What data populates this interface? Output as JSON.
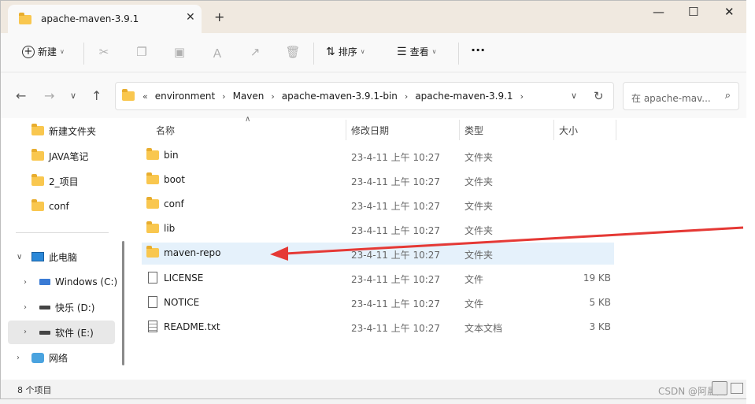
{
  "window": {
    "tab_title": "apache-maven-3.9.1",
    "tab_close": "✕",
    "new_tab": "+",
    "minimize": "—",
    "maximize": "☐",
    "close": "✕"
  },
  "toolbar": {
    "new_label": "新建",
    "sort_label": "排序",
    "view_label": "查看",
    "more_label": "···"
  },
  "address": {
    "prefix": "«",
    "crumbs": [
      "environment",
      "Maven",
      "apache-maven-3.9.1-bin",
      "apache-maven-3.9.1"
    ],
    "search_placeholder": "在 apache-mav..."
  },
  "sidebar": {
    "items": [
      {
        "label": "新建文件夹",
        "icon": "folder-icon"
      },
      {
        "label": "JAVA笔记",
        "icon": "folder-icon"
      },
      {
        "label": "2_项目",
        "icon": "folder-icon"
      },
      {
        "label": "conf",
        "icon": "folder-icon"
      },
      {
        "label": "此电脑",
        "icon": "pc-icon"
      },
      {
        "label": "Windows (C:)",
        "icon": "windows-drive-icon"
      },
      {
        "label": "快乐 (D:)",
        "icon": "drive-icon"
      },
      {
        "label": "软件 (E:)",
        "icon": "drive-icon"
      },
      {
        "label": "网络",
        "icon": "network-icon"
      }
    ]
  },
  "columns": {
    "name": "名称",
    "date": "修改日期",
    "type": "类型",
    "size": "大小"
  },
  "files": [
    {
      "name": "bin",
      "date": "23-4-11 上午 10:27",
      "type": "文件夹",
      "size": "",
      "icon": "folder-icon"
    },
    {
      "name": "boot",
      "date": "23-4-11 上午 10:27",
      "type": "文件夹",
      "size": "",
      "icon": "folder-icon"
    },
    {
      "name": "conf",
      "date": "23-4-11 上午 10:27",
      "type": "文件夹",
      "size": "",
      "icon": "folder-icon"
    },
    {
      "name": "lib",
      "date": "23-4-11 上午 10:27",
      "type": "文件夹",
      "size": "",
      "icon": "folder-icon"
    },
    {
      "name": "maven-repo",
      "date": "23-4-11 上午 10:27",
      "type": "文件夹",
      "size": "",
      "icon": "folder-icon"
    },
    {
      "name": "LICENSE",
      "date": "23-4-11 上午 10:27",
      "type": "文件",
      "size": "19 KB",
      "icon": "document-icon"
    },
    {
      "name": "NOTICE",
      "date": "23-4-11 上午 10:27",
      "type": "文件",
      "size": "5 KB",
      "icon": "document-icon"
    },
    {
      "name": "README.txt",
      "date": "23-4-11 上午 10:27",
      "type": "文本文档",
      "size": "3 KB",
      "icon": "text-document-icon"
    }
  ],
  "status": {
    "item_count": "8 个项目",
    "watermark": "CSDN @阿晨要"
  },
  "colors": {
    "selection": "#e5f1fb",
    "annotation_arrow": "#e53935",
    "titlebar": "#f0e9e0"
  }
}
